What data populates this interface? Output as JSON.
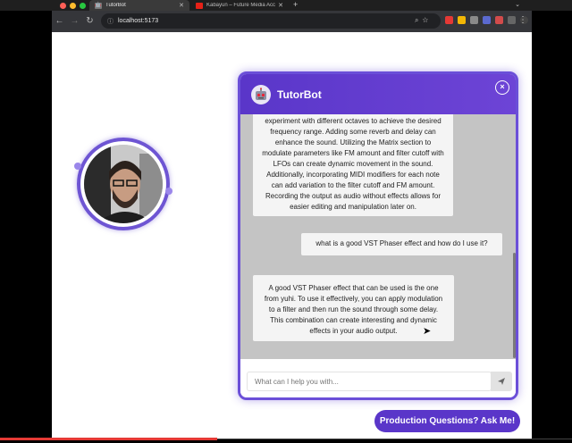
{
  "browser": {
    "tabs": [
      {
        "title": "TutorBot",
        "active": true
      },
      {
        "title": "Kabayun – Future Media Acc",
        "active": false
      }
    ],
    "new_tab": "+",
    "url": "localhost:5173"
  },
  "chat": {
    "title": "TutorBot",
    "close": "×",
    "messages": [
      {
        "role": "bot",
        "text": "experiment with different octaves to achieve the desired frequency range. Adding some reverb and delay can enhance the sound. Utilizing the Matrix section to modulate parameters like FM amount and filter cutoff with LFOs can create dynamic movement in the sound. Additionally, incorporating MIDI modifiers for each note can add variation to the filter cutoff and FM amount. Recording the output as audio without effects allows for easier editing and manipulation later on."
      },
      {
        "role": "user",
        "text": "what is a good VST Phaser effect and how do I use it?"
      },
      {
        "role": "bot",
        "text": "A good VST Phaser effect that can be used is the one from yuhi. To use it effectively, you can apply modulation to a filter and then run the sound through some delay. This combination can create interesting and dynamic effects in your audio output."
      }
    ],
    "input_placeholder": "What can I help you with...",
    "send_icon": "send-icon"
  },
  "cta": {
    "label": "Production Questions? Ask Me!"
  },
  "colors": {
    "accent": "#5a36c9",
    "chat_bg": "#c4c4c4",
    "bubble": "#f4f4f4"
  }
}
